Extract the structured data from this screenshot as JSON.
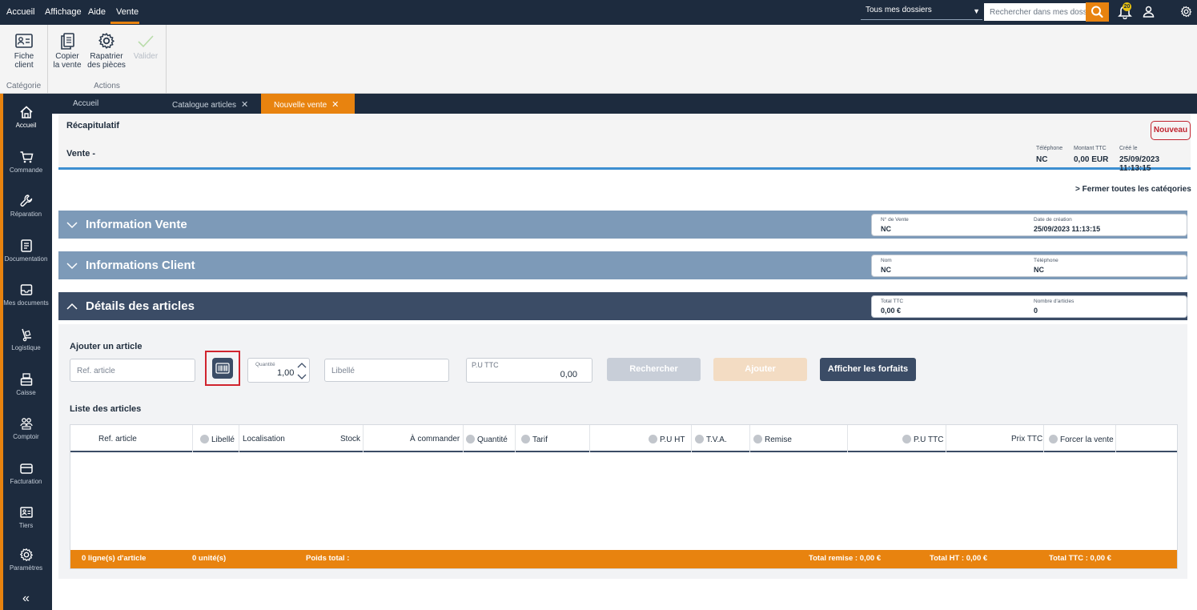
{
  "menubar": {
    "items": [
      "Accueil",
      "Affichage",
      "Aide",
      "Vente"
    ],
    "folder_select": "Tous mes dossiers",
    "search_placeholder": "Rechercher dans mes dossiers",
    "notification_count": "20"
  },
  "ribbon": {
    "groups": [
      {
        "label": "Catégorie",
        "buttons": [
          {
            "label1": "Fiche",
            "label2": "client",
            "icon": "id-card-icon"
          }
        ]
      },
      {
        "label": "Actions",
        "buttons": [
          {
            "label1": "Copier",
            "label2": "la vente",
            "icon": "copy-icon"
          },
          {
            "label1": "Rapatrier",
            "label2": "des pièces",
            "icon": "gear-icon"
          },
          {
            "label1": "Valider",
            "label2": "",
            "icon": "check-icon",
            "disabled": true
          }
        ]
      }
    ]
  },
  "sidebar": {
    "items": [
      {
        "label": "Accueil",
        "icon": "home-icon",
        "active": true
      },
      {
        "label": "Commande",
        "icon": "cart-icon"
      },
      {
        "label": "Réparation",
        "icon": "wrench-icon"
      },
      {
        "label": "Documentation",
        "icon": "document-icon"
      },
      {
        "label": "Mes documents",
        "icon": "inbox-icon"
      },
      {
        "label": "Logistique",
        "icon": "hand-truck-icon"
      },
      {
        "label": "Caisse",
        "icon": "register-icon"
      },
      {
        "label": "Comptoir",
        "icon": "users-icon"
      },
      {
        "label": "Facturation",
        "icon": "credit-card-icon"
      },
      {
        "label": "Tiers",
        "icon": "contact-card-icon"
      },
      {
        "label": "Paramètres",
        "icon": "gear-icon"
      }
    ],
    "collapse_label": "«"
  },
  "tabs": [
    {
      "label": "Accueil",
      "closable": false
    },
    {
      "label": "Catalogue articles",
      "closable": true
    },
    {
      "label": "Nouvelle vente",
      "closable": true,
      "active": true
    }
  ],
  "summary": {
    "title": "Récapitulatif",
    "vente": "Vente -",
    "badge": "Nouveau",
    "fields": [
      {
        "label": "Téléphone",
        "value": "NC"
      },
      {
        "label": "Montant TTC",
        "value": "0,00 EUR"
      },
      {
        "label": "Créé le",
        "value": "25/09/2023 11:13:15"
      }
    ],
    "close_all": "> Fermer toutes les catéqories"
  },
  "sections": [
    {
      "title": "Information Vente",
      "expanded": false,
      "fields": [
        {
          "label": "N° de Vente",
          "value": "NC"
        },
        {
          "label": "Date de création",
          "value": "25/09/2023 11:13:15"
        }
      ]
    },
    {
      "title": "Informations Client",
      "expanded": false,
      "fields": [
        {
          "label": "Nom",
          "value": "NC"
        },
        {
          "label": "Téléphone",
          "value": "NC"
        }
      ]
    },
    {
      "title": "Détails des articles",
      "expanded": true,
      "fields": [
        {
          "label": "Total TTC",
          "value": "0,00 €"
        },
        {
          "label": "Nombre d'articles",
          "value": "0"
        }
      ]
    }
  ],
  "add_article": {
    "title": "Ajouter un article",
    "ref_placeholder": "Ref. article",
    "qty_label": "Quantité",
    "qty_value": "1,00",
    "libelle_placeholder": "Libellé",
    "pu_label": "P.U TTC",
    "pu_value": "0,00",
    "search_button": "Rechercher",
    "add_button": "Ajouter",
    "forfaits_button": "Afficher les forfaits"
  },
  "article_list": {
    "title": "Liste des articles",
    "columns": [
      "Ref. article",
      "Libellé",
      "Localisation",
      "Stock",
      "À commander",
      "Quantité",
      "Tarif",
      "P.U HT",
      "T.V.A.",
      "Remise",
      "P.U TTC",
      "Prix TTC",
      "Forcer la vente"
    ],
    "rows": [],
    "footer": {
      "lines": "0 ligne(s) d'article",
      "units": "0 unité(s)",
      "weight": "Poids total :",
      "total_remise": "Total remise : 0,00 €",
      "total_ht": "Total HT : 0,00 €",
      "total_ttc": "Total TTC : 0,00 €"
    }
  },
  "colors": {
    "navy": "#1d2b3e",
    "accent": "#e8830f",
    "section_collapsed": "#7d9ab8",
    "section_expanded": "#3b4c66",
    "danger": "#c0242f"
  }
}
